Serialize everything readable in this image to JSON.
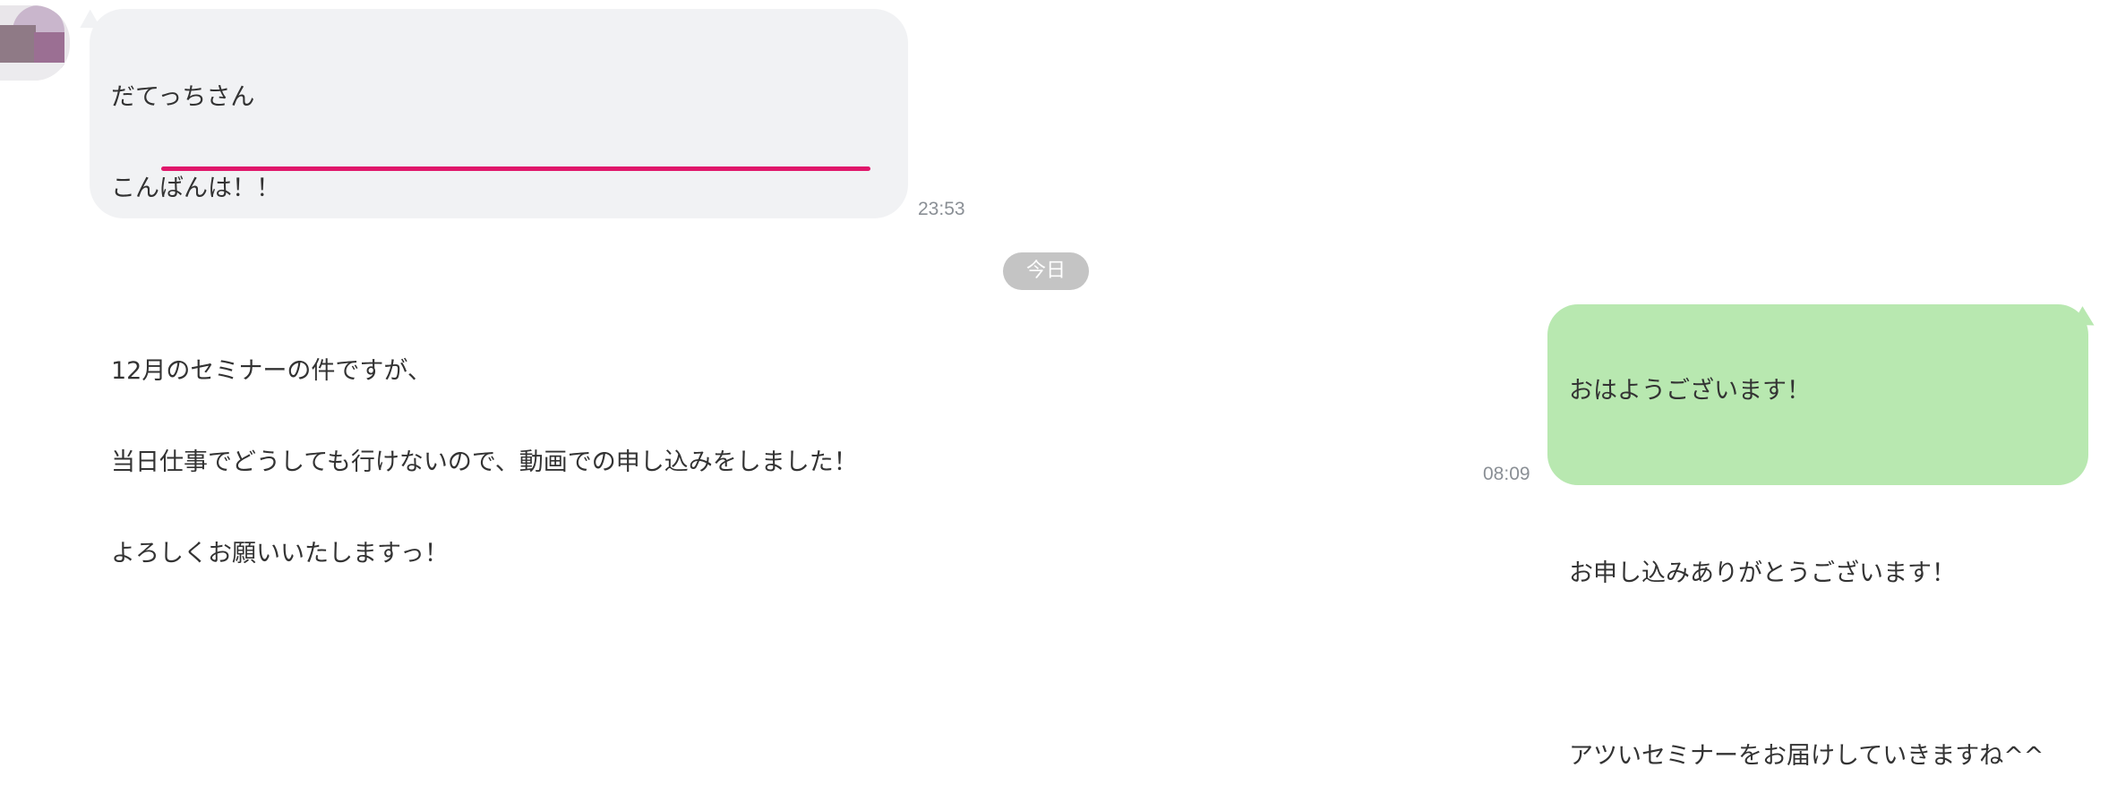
{
  "messages": [
    {
      "direction": "incoming",
      "lines": [
        "だてっちさん",
        "こんばんは！！",
        "",
        "12月のセミナーの件ですが、",
        "当日仕事でどうしても行けないので、動画での申し込みをしました！",
        "よろしくお願いいたしますっ！"
      ],
      "time": "23:53",
      "highlight_color": "#e0176b"
    },
    {
      "direction": "outgoing",
      "lines": [
        "おはようございます！",
        "",
        "お申し込みありがとうございます！",
        "",
        "アツいセミナーをお届けしていきますね^^"
      ],
      "time": "08:09"
    }
  ],
  "date_separator": "今日",
  "colors": {
    "incoming_bubble": "#f1f2f4",
    "outgoing_bubble": "#b8e8b0",
    "date_pill": "#c4c4c4",
    "timestamp": "#8a8f95"
  }
}
